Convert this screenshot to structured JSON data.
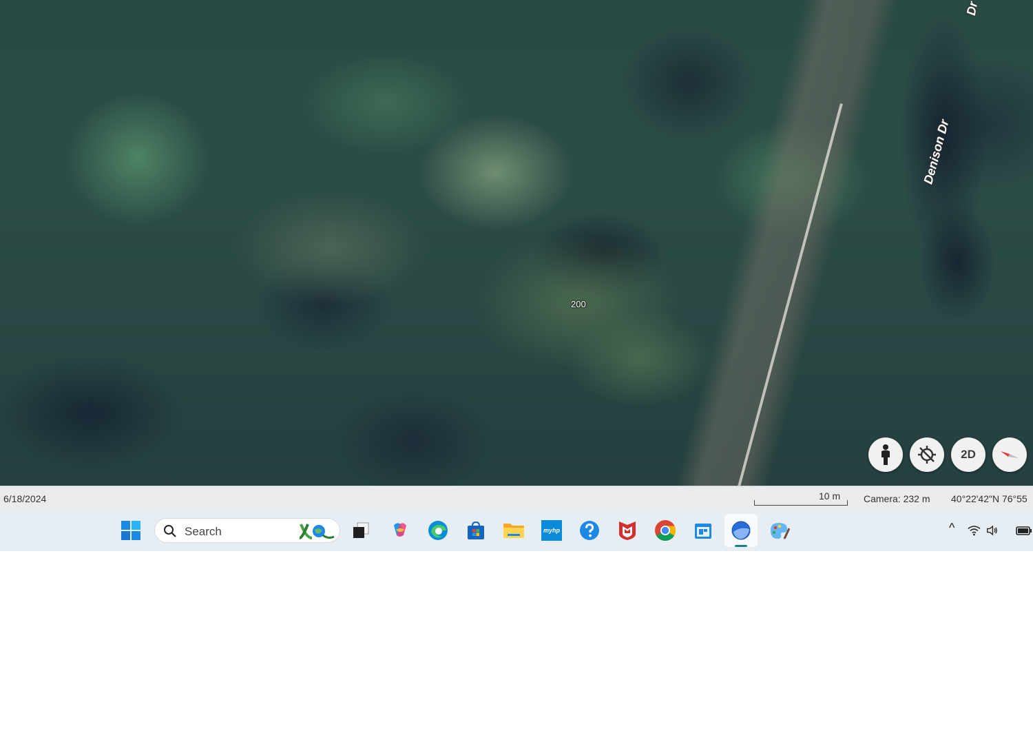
{
  "map": {
    "street_main": "Denison Dr",
    "street_top": "Dr",
    "address_number": "200",
    "controls": {
      "pegman_icon": "person-icon",
      "location_icon": "location-off-icon",
      "view_mode_label": "2D",
      "compass_icon": "compass-icon"
    }
  },
  "statusbar": {
    "imagery_date": "6/18/2024",
    "scale_label": "10 m",
    "camera": "Camera: 232 m",
    "coordinates": "40°22'42\"N 76°55"
  },
  "taskbar": {
    "search_placeholder": "Search",
    "apps": [
      {
        "name": "start-icon"
      },
      {
        "name": "task-view-icon"
      },
      {
        "name": "copilot-icon"
      },
      {
        "name": "edge-icon"
      },
      {
        "name": "store-icon"
      },
      {
        "name": "file-explorer-icon"
      },
      {
        "name": "myhp-icon"
      },
      {
        "name": "help-icon"
      },
      {
        "name": "mcafee-icon"
      },
      {
        "name": "chrome-icon"
      },
      {
        "name": "remote-app-icon"
      },
      {
        "name": "google-earth-icon"
      },
      {
        "name": "paint-icon"
      }
    ],
    "myhp_label": "myhp",
    "tray": {
      "chevron": "^",
      "icons": [
        "wifi-icon",
        "volume-icon",
        "battery-icon"
      ]
    }
  }
}
